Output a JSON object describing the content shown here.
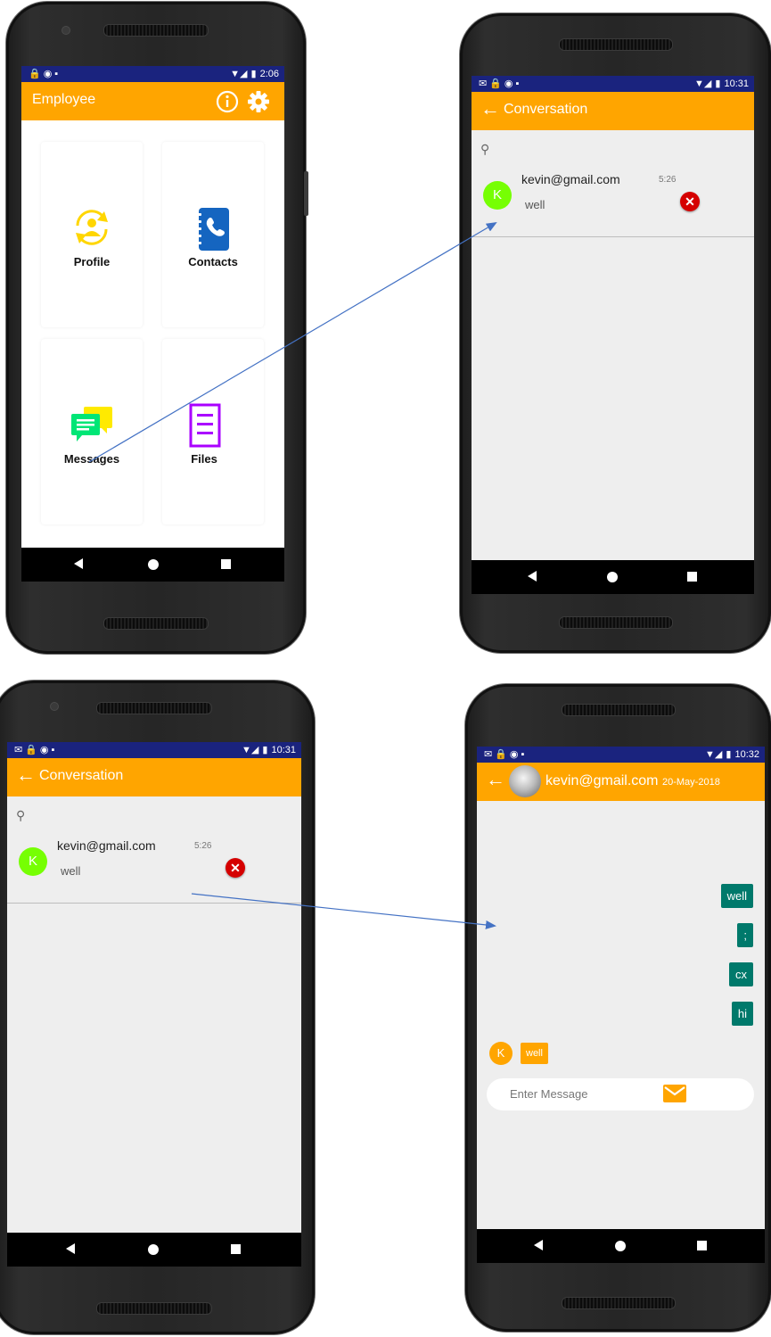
{
  "colors": {
    "toolbar": "#ffa500",
    "statusbar": "#1a237e",
    "arrow": "#4472c4",
    "avatar_contact": "#76ff03",
    "bubble_out": "#00796b",
    "bubble_in": "#ffa500",
    "delete": "#d50000"
  },
  "screens": {
    "home": {
      "status_time": "2:06",
      "title": "Employee",
      "info_icon": "info-circle-icon",
      "settings_icon": "gear-icon",
      "cards": [
        {
          "label": "Profile",
          "icon": "profile-sync-icon"
        },
        {
          "label": "Contacts",
          "icon": "contacts-book-icon"
        },
        {
          "label": "Messages",
          "icon": "chat-bubbles-icon"
        },
        {
          "label": "Files",
          "icon": "document-icon"
        }
      ]
    },
    "conversation_a": {
      "status_time": "10:31",
      "title": "Conversation",
      "item": {
        "initial": "K",
        "name": "kevin@gmail.com",
        "time": "5:26",
        "last_message": "well"
      }
    },
    "conversation_b": {
      "status_time": "10:31",
      "title": "Conversation",
      "item": {
        "initial": "K",
        "name": "kevin@gmail.com",
        "time": "5:26",
        "last_message": "well"
      }
    },
    "chat": {
      "status_time": "10:32",
      "contact": "kevin@gmail.com",
      "date": "20-May-2018",
      "messages_out": [
        "well",
        ";",
        "cx",
        "hi"
      ],
      "message_in": {
        "initial": "K",
        "text": "well"
      },
      "input_placeholder": "Enter Message"
    }
  }
}
